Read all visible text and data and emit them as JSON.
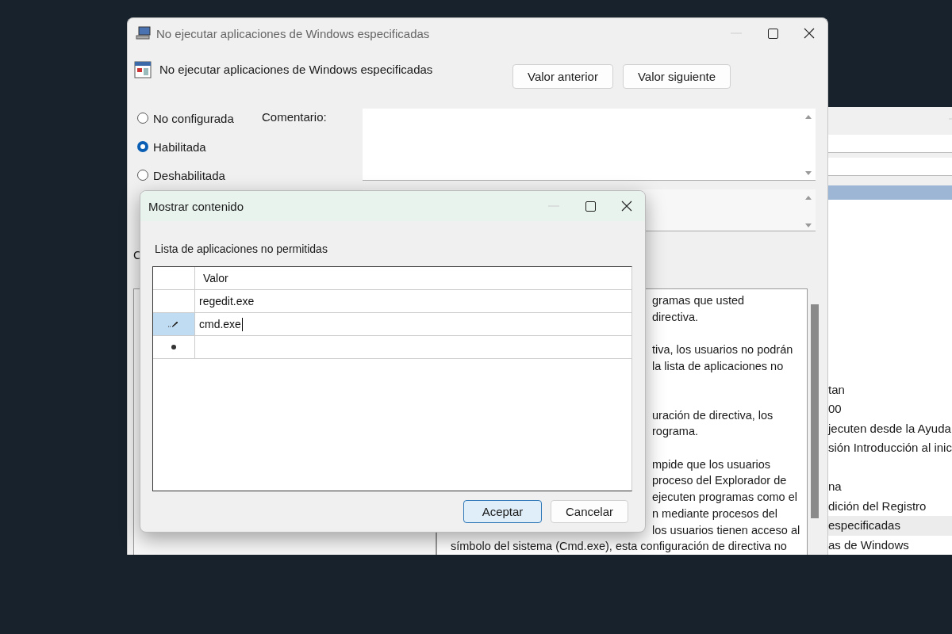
{
  "main_window": {
    "title": "No ejecutar aplicaciones de Windows especificadas",
    "heading": "No ejecutar aplicaciones de Windows especificadas",
    "buttons": [
      "Valor anterior",
      "Valor siguiente"
    ],
    "options": [
      {
        "label": "No configurada",
        "selected": false
      },
      {
        "label": "Habilitada",
        "selected": true
      },
      {
        "label": "Deshabilitada",
        "selected": false
      }
    ],
    "comment_label": "Comentario:",
    "section_label": "C",
    "help_lines": [
      {
        "kind": "partial",
        "text": "gramas que usted"
      },
      {
        "kind": "partial",
        "text": "directiva."
      },
      {
        "kind": "gap"
      },
      {
        "kind": "partial",
        "text": "tiva, los usuarios no podrán"
      },
      {
        "kind": "partial",
        "text": "la lista de aplicaciones no"
      },
      {
        "kind": "gap"
      },
      {
        "kind": "gap"
      },
      {
        "kind": "partial",
        "text": "uración de directiva, los"
      },
      {
        "kind": "partial",
        "text": "rograma."
      },
      {
        "kind": "gap"
      },
      {
        "kind": "partial",
        "text": "mpide que los usuarios"
      },
      {
        "kind": "partial",
        "text": "proceso del Explorador de"
      },
      {
        "kind": "partial",
        "text": "ejecuten programas como el"
      },
      {
        "kind": "partial",
        "text": "n mediante procesos del"
      },
      {
        "kind": "partial",
        "text": "los usuarios tienen acceso al"
      },
      {
        "kind": "full",
        "text": "símbolo del sistema (Cmd.exe), esta configuración de directiva no"
      }
    ]
  },
  "back_window": {
    "list_groups": [
      [
        {
          "text": "tan",
          "selected": false
        },
        {
          "text": "00",
          "selected": false
        },
        {
          "text": "jecuten desde la Ayuda",
          "selected": false
        },
        {
          "text": "sión Introducción al inic",
          "selected": false
        }
      ],
      [
        {
          "text": "na",
          "selected": false
        },
        {
          "text": "dición del Registro",
          "selected": false
        },
        {
          "text": "especificadas",
          "selected": true
        },
        {
          "text": "as de Windows",
          "selected": false
        }
      ]
    ]
  },
  "dialog": {
    "title": "Mostrar contenido",
    "label": "Lista de aplicaciones no permitidas",
    "column": "Valor",
    "rows": [
      {
        "kind": "value",
        "value": "regedit.exe",
        "selected": false
      },
      {
        "kind": "editing",
        "value": "cmd.exe",
        "selected": true
      },
      {
        "kind": "new",
        "selected": false
      }
    ],
    "buttons": [
      {
        "label": "Aceptar",
        "default": true
      },
      {
        "label": "Cancelar",
        "default": false
      }
    ]
  }
}
